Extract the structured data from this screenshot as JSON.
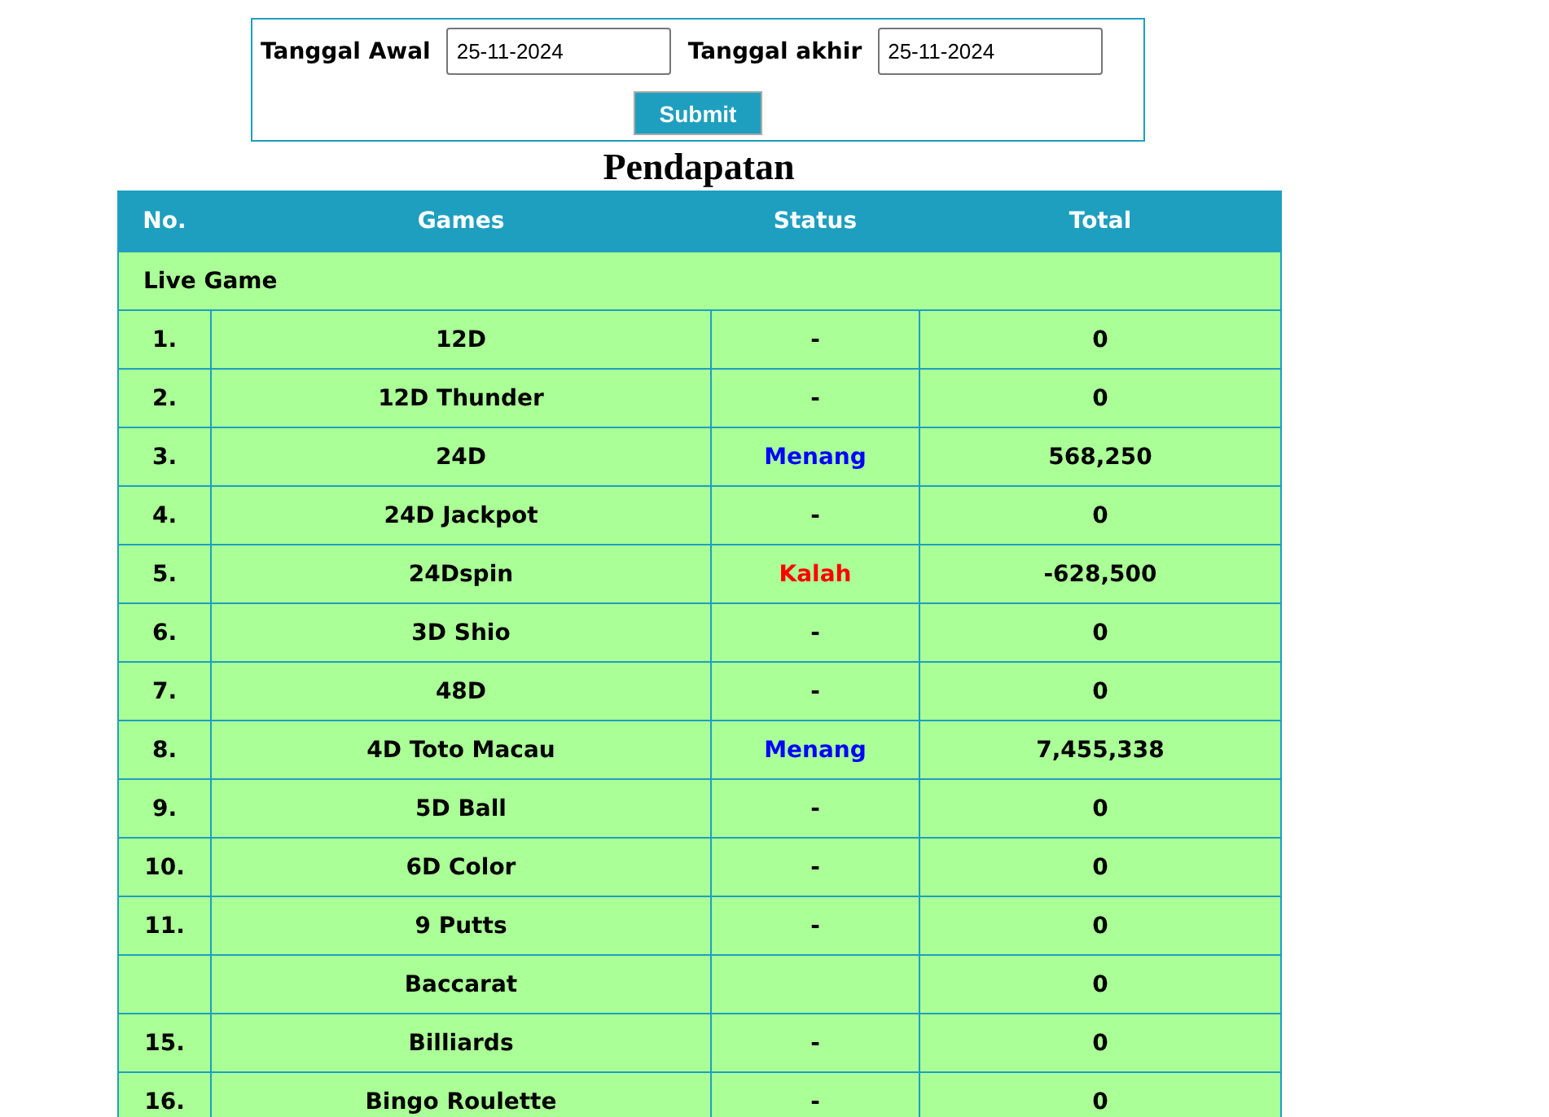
{
  "form": {
    "start_label": "Tanggal Awal",
    "start_value": "25-11-2024",
    "end_label": "Tanggal akhir",
    "end_value": "25-11-2024",
    "submit": "Submit"
  },
  "title": "Pendapatan",
  "table": {
    "columns": [
      "No.",
      "Games",
      "Status",
      "Total"
    ],
    "section": "Live Game",
    "rows": [
      {
        "no": "1.",
        "game": "12D",
        "status": {
          "text": "-",
          "kind": "plain"
        },
        "total": "0"
      },
      {
        "no": "2.",
        "game": "12D Thunder",
        "status": {
          "text": "-",
          "kind": "plain"
        },
        "total": "0"
      },
      {
        "no": "3.",
        "game": "24D",
        "status": {
          "text": "Menang",
          "kind": "win"
        },
        "total": "568,250"
      },
      {
        "no": "4.",
        "game": "24D Jackpot",
        "status": {
          "text": "-",
          "kind": "plain"
        },
        "total": "0"
      },
      {
        "no": "5.",
        "game": "24Dspin",
        "status": {
          "text": "Kalah",
          "kind": "lose"
        },
        "total": "-628,500"
      },
      {
        "no": "6.",
        "game": "3D Shio",
        "status": {
          "text": "-",
          "kind": "plain"
        },
        "total": "0"
      },
      {
        "no": "7.",
        "game": "48D",
        "status": {
          "text": "-",
          "kind": "plain"
        },
        "total": "0"
      },
      {
        "no": "8.",
        "game": "4D Toto Macau",
        "status": {
          "text": "Menang",
          "kind": "win"
        },
        "total": "7,455,338"
      },
      {
        "no": "9.",
        "game": "5D Ball",
        "status": {
          "text": "-",
          "kind": "plain"
        },
        "total": "0"
      },
      {
        "no": "10.",
        "game": "6D Color",
        "status": {
          "text": "-",
          "kind": "plain"
        },
        "total": "0"
      },
      {
        "no": "11.",
        "game": "9 Putts",
        "status": {
          "text": "-",
          "kind": "plain"
        },
        "total": "0"
      },
      {
        "game": "Baccarat",
        "total": "0"
      },
      {
        "no": "15.",
        "game": "Billiards",
        "status": {
          "text": "-",
          "kind": "plain"
        },
        "total": "0"
      },
      {
        "no": "16.",
        "game": "Bingo Roulette",
        "status": {
          "text": "-",
          "kind": "plain"
        },
        "total": "0"
      }
    ]
  }
}
